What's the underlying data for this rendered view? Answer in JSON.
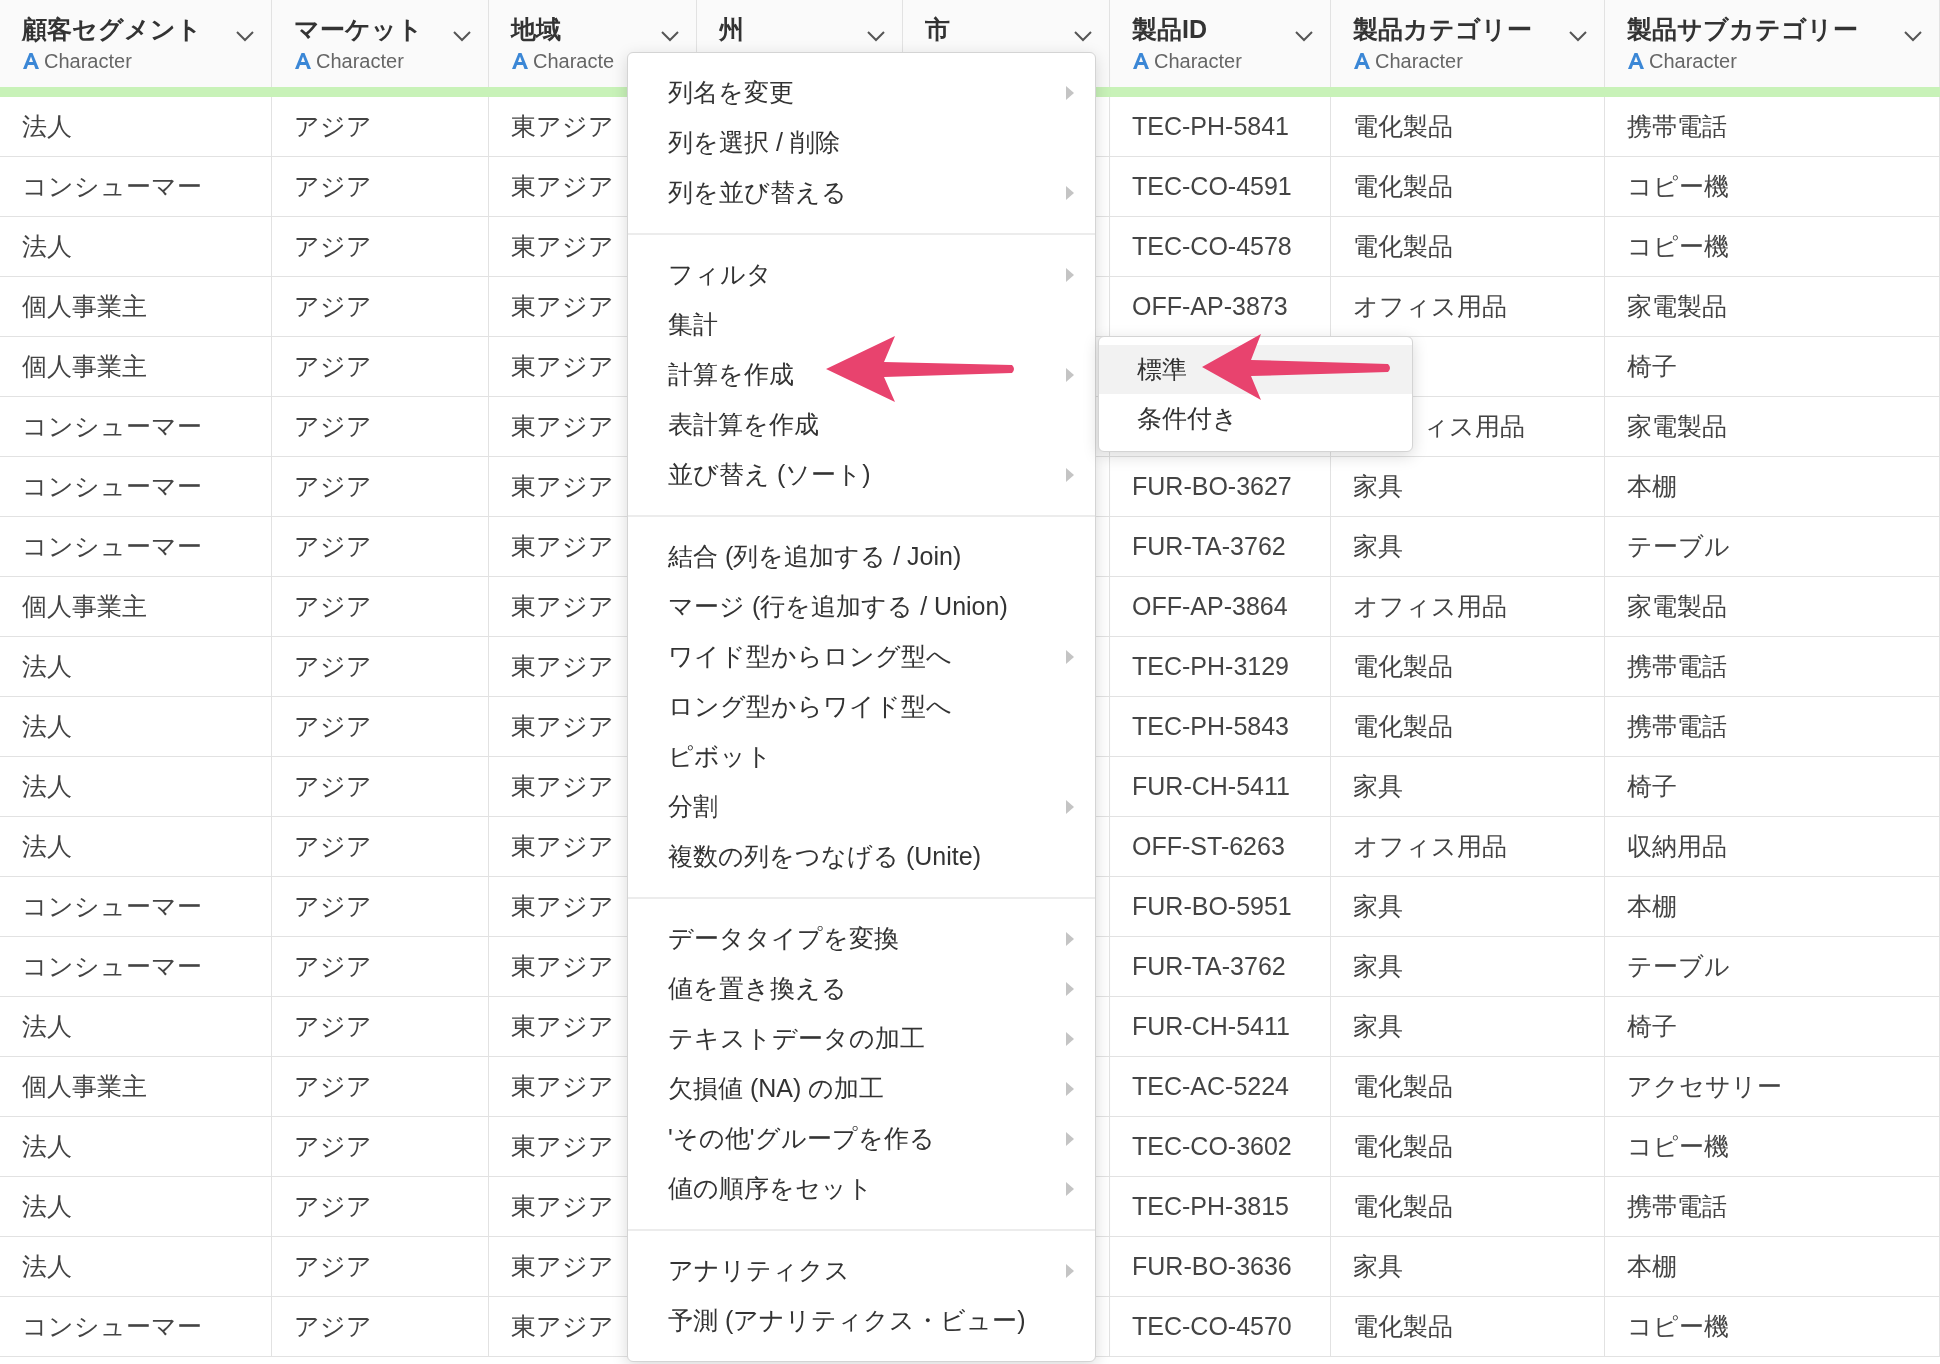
{
  "columns": [
    {
      "name": "顧客セグメント",
      "type": "Character"
    },
    {
      "name": "マーケット",
      "type": "Character"
    },
    {
      "name": "地域",
      "type": "Characte"
    },
    {
      "name": "州"
    },
    {
      "name": "市"
    },
    {
      "name": "製品ID",
      "type": "Character"
    },
    {
      "name": "製品カテゴリー",
      "type": "Character"
    },
    {
      "name": "製品サブカテゴリー",
      "type": "Character"
    }
  ],
  "rows": [
    [
      "法人",
      "アジア",
      "東アジア",
      null,
      null,
      "TEC-PH-5841",
      "電化製品",
      "携帯電話"
    ],
    [
      "コンシューマー",
      "アジア",
      "東アジア",
      null,
      null,
      "TEC-CO-4591",
      "電化製品",
      "コピー機"
    ],
    [
      "法人",
      "アジア",
      "東アジア",
      null,
      null,
      "TEC-CO-4578",
      "電化製品",
      "コピー機"
    ],
    [
      "個人事業主",
      "アジア",
      "東アジア",
      null,
      null,
      "OFF-AP-3873",
      "オフィス用品",
      "家電製品"
    ],
    [
      "個人事業主",
      "アジア",
      "東アジア",
      null,
      null,
      null,
      null,
      "椅子"
    ],
    [
      "コンシューマー",
      "アジア",
      "東アジア",
      null,
      null,
      null,
      {
        "kind": "partial",
        "text": "ィス用品"
      },
      "家電製品"
    ],
    [
      "コンシューマー",
      "アジア",
      "東アジア",
      null,
      null,
      "FUR-BO-3627",
      "家具",
      "本棚"
    ],
    [
      "コンシューマー",
      "アジア",
      "東アジア",
      null,
      null,
      "FUR-TA-3762",
      "家具",
      "テーブル"
    ],
    [
      "個人事業主",
      "アジア",
      "東アジア",
      null,
      null,
      "OFF-AP-3864",
      "オフィス用品",
      "家電製品"
    ],
    [
      "法人",
      "アジア",
      "東アジア",
      null,
      null,
      "TEC-PH-3129",
      "電化製品",
      "携帯電話"
    ],
    [
      "法人",
      "アジア",
      "東アジア",
      null,
      null,
      "TEC-PH-5843",
      "電化製品",
      "携帯電話"
    ],
    [
      "法人",
      "アジア",
      "東アジア",
      null,
      null,
      "FUR-CH-5411",
      "家具",
      "椅子"
    ],
    [
      "法人",
      "アジア",
      "東アジア",
      null,
      null,
      "OFF-ST-6263",
      "オフィス用品",
      "収納用品"
    ],
    [
      "コンシューマー",
      "アジア",
      "東アジア",
      null,
      null,
      "FUR-BO-5951",
      "家具",
      "本棚"
    ],
    [
      "コンシューマー",
      "アジア",
      "東アジア",
      null,
      null,
      "FUR-TA-3762",
      "家具",
      "テーブル"
    ],
    [
      "法人",
      "アジア",
      "東アジア",
      null,
      null,
      "FUR-CH-5411",
      "家具",
      "椅子"
    ],
    [
      "個人事業主",
      "アジア",
      "東アジア",
      null,
      null,
      "TEC-AC-5224",
      "電化製品",
      "アクセサリー"
    ],
    [
      "法人",
      "アジア",
      "東アジア",
      null,
      null,
      "TEC-CO-3602",
      "電化製品",
      "コピー機"
    ],
    [
      "法人",
      "アジア",
      "東アジア",
      null,
      null,
      "TEC-PH-3815",
      "電化製品",
      "携帯電話"
    ],
    [
      "法人",
      "アジア",
      "東アジア",
      null,
      null,
      "FUR-BO-3636",
      "家具",
      "本棚"
    ],
    [
      "コンシューマー",
      "アジア",
      "東アジア",
      null,
      null,
      "TEC-CO-4570",
      "電化製品",
      "コピー機"
    ]
  ],
  "context_menu": {
    "sections": [
      [
        {
          "label": "列名を変更",
          "submenu": true
        },
        {
          "label": "列を選択 / 削除",
          "submenu": false
        },
        {
          "label": "列を並び替える",
          "submenu": true
        }
      ],
      [
        {
          "label": "フィルタ",
          "submenu": true
        },
        {
          "label": "集計",
          "submenu": false
        },
        {
          "label": "計算を作成",
          "submenu": true
        },
        {
          "label": "表計算を作成",
          "submenu": false
        },
        {
          "label": "並び替え (ソート)",
          "submenu": true
        }
      ],
      [
        {
          "label": "結合 (列を追加する / Join)",
          "submenu": false
        },
        {
          "label": "マージ (行を追加する / Union)",
          "submenu": false
        },
        {
          "label": "ワイド型からロング型へ",
          "submenu": true
        },
        {
          "label": "ロング型からワイド型へ",
          "submenu": false
        },
        {
          "label": "ピボット",
          "submenu": false
        },
        {
          "label": "分割",
          "submenu": true
        },
        {
          "label": "複数の列をつなげる (Unite)",
          "submenu": false
        }
      ],
      [
        {
          "label": "データタイプを変換",
          "submenu": true
        },
        {
          "label": "値を置き換える",
          "submenu": true
        },
        {
          "label": "テキストデータの加工",
          "submenu": true
        },
        {
          "label": "欠損値 (NA) の加工",
          "submenu": true
        },
        {
          "label": "'その他'グループを作る",
          "submenu": true
        },
        {
          "label": "値の順序をセット",
          "submenu": true
        }
      ],
      [
        {
          "label": "アナリティクス",
          "submenu": true
        },
        {
          "label": "予測 (アナリティクス・ビュー)",
          "submenu": false
        }
      ]
    ]
  },
  "submenu": {
    "items": [
      {
        "label": "標準",
        "selected": true
      },
      {
        "label": "条件付き",
        "selected": false
      }
    ]
  }
}
